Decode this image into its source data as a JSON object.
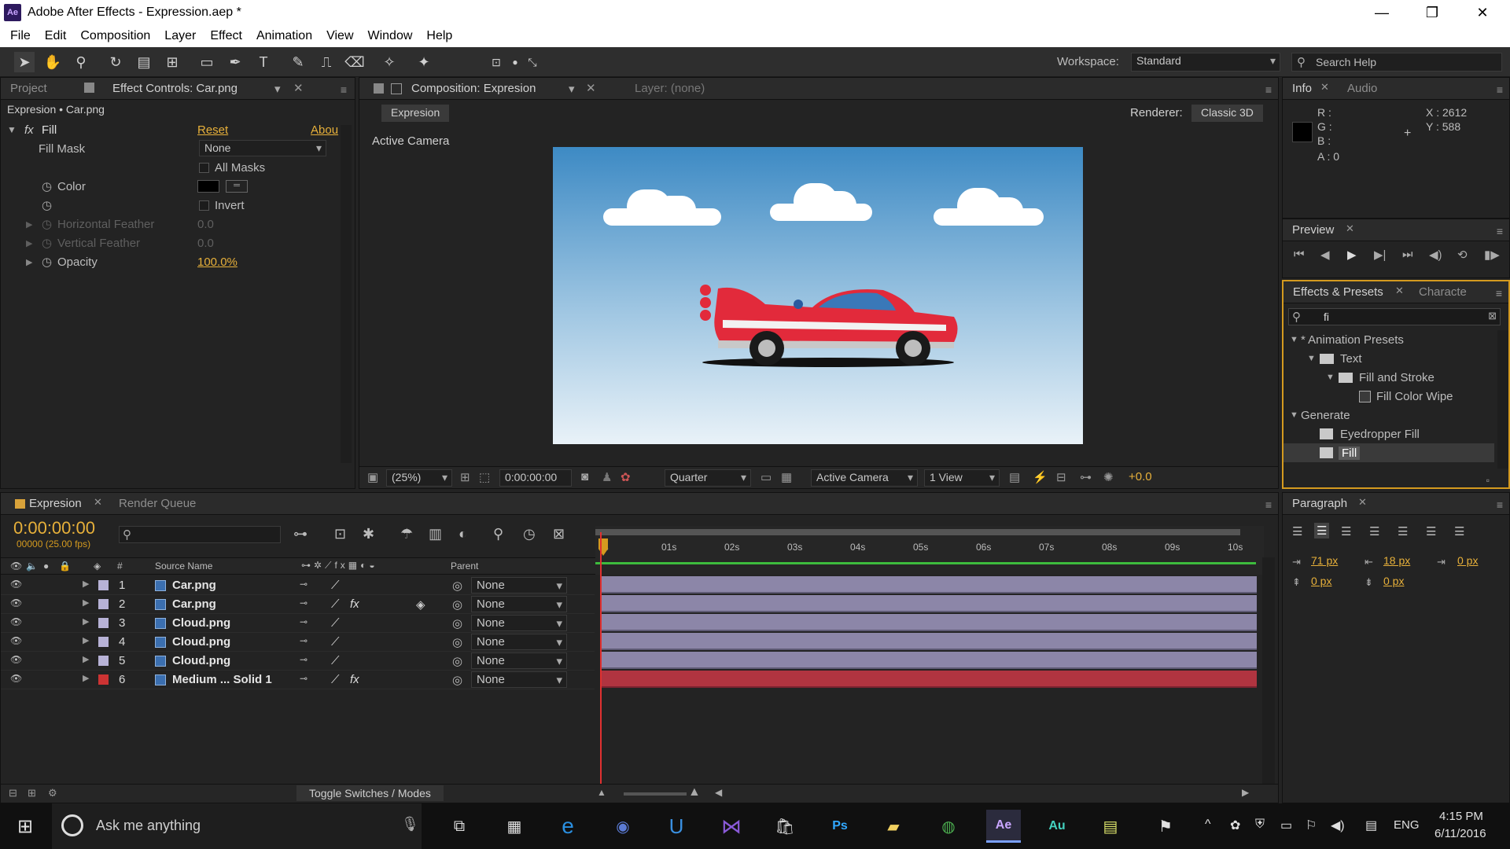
{
  "window": {
    "title": "Adobe After Effects - Expression.aep *",
    "app_icon": "Ae"
  },
  "menu": [
    "File",
    "Edit",
    "Composition",
    "Layer",
    "Effect",
    "Animation",
    "View",
    "Window",
    "Help"
  ],
  "toolbar": {
    "workspace_label": "Workspace:",
    "workspace_value": "Standard",
    "search_placeholder": "Search Help"
  },
  "effect_controls": {
    "tab_project": "Project",
    "tab_label": "Effect Controls: Car.png",
    "breadcrumb": "Expresion • Car.png",
    "effect_name": "Fill",
    "reset": "Reset",
    "about": "Abou",
    "fill_mask_label": "Fill Mask",
    "fill_mask_value": "None",
    "all_masks": "All Masks",
    "color_label": "Color",
    "invert": "Invert",
    "h_feather_label": "Horizontal Feather",
    "h_feather_value": "0.0",
    "v_feather_label": "Vertical Feather",
    "v_feather_value": "0.0",
    "opacity_label": "Opacity",
    "opacity_value": "100.0%"
  },
  "composition": {
    "tab_label": "Composition: Expresion",
    "layer_tab": "Layer: (none)",
    "comp_name": "Expresion",
    "renderer_label": "Renderer:",
    "renderer_value": "Classic 3D",
    "camera_label": "Active Camera",
    "zoom": "(25%)",
    "timecode": "0:00:00:00",
    "resolution": "Quarter",
    "view_camera": "Active Camera",
    "views": "1 View",
    "exposure": "+0.0"
  },
  "info": {
    "tab": "Info",
    "tab2": "Audio",
    "r": "R :",
    "g": "G :",
    "b": "B :",
    "a": "A : 0",
    "x": "X : 2612",
    "y": "Y : 588"
  },
  "preview": {
    "tab": "Preview"
  },
  "effects_presets": {
    "tab": "Effects & Presets",
    "tab2": "Characte",
    "search_value": "fi",
    "tree": [
      {
        "label": "* Animation Presets",
        "level": 0,
        "kind": "group"
      },
      {
        "label": "Text",
        "level": 1,
        "kind": "folder"
      },
      {
        "label": "Fill and Stroke",
        "level": 2,
        "kind": "folder"
      },
      {
        "label": "Fill Color Wipe",
        "level": 3,
        "kind": "preset"
      },
      {
        "label": "Generate",
        "level": 0,
        "kind": "group"
      },
      {
        "label": "Eyedropper Fill",
        "level": 1,
        "kind": "effect"
      },
      {
        "label": "Fill",
        "level": 1,
        "kind": "effect-selected"
      }
    ]
  },
  "timeline": {
    "tab": "Expresion",
    "render_queue": "Render Queue",
    "timecode": "0:00:00:00",
    "frames": "00000 (25.00 fps)",
    "col_source": "Source Name",
    "col_parent": "Parent",
    "toggle": "Toggle Switches / Modes",
    "ruler": [
      "0s",
      "01s",
      "02s",
      "03s",
      "04s",
      "05s",
      "06s",
      "07s",
      "08s",
      "09s",
      "10s"
    ],
    "layers": [
      {
        "num": "1",
        "name": "Car.png",
        "parent": "None",
        "color": "#b7b2d6",
        "fx": false
      },
      {
        "num": "2",
        "name": "Car.png",
        "parent": "None",
        "color": "#b7b2d6",
        "fx": true
      },
      {
        "num": "3",
        "name": "Cloud.png",
        "parent": "None",
        "color": "#b7b2d6",
        "fx": false
      },
      {
        "num": "4",
        "name": "Cloud.png",
        "parent": "None",
        "color": "#b7b2d6",
        "fx": false
      },
      {
        "num": "5",
        "name": "Cloud.png",
        "parent": "None",
        "color": "#b7b2d6",
        "fx": false
      },
      {
        "num": "6",
        "name": "Medium ... Solid 1",
        "parent": "None",
        "color": "#cc3333",
        "fx": true
      }
    ]
  },
  "paragraph": {
    "tab": "Paragraph",
    "indent_left": "71 px",
    "indent_right": "18 px",
    "first_line": "0 px",
    "space_before": "0 px",
    "space_after": "0 px",
    "space_third": "0 px"
  },
  "taskbar": {
    "search": "Ask me anything",
    "lang": "ENG",
    "time": "4:15 PM",
    "date": "6/11/2016"
  }
}
